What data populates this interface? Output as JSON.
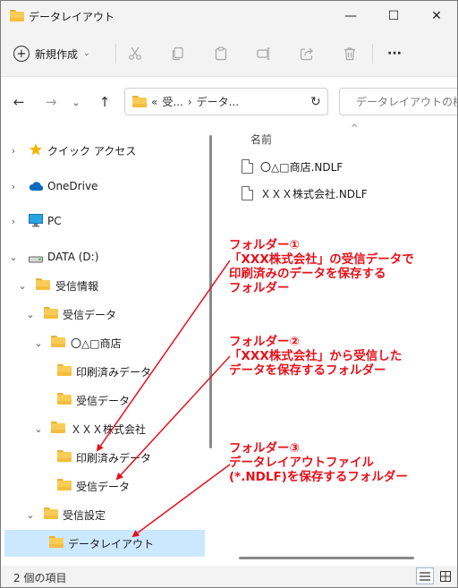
{
  "window": {
    "title": "データレイアウト",
    "minimize_glyph": "—",
    "maximize_glyph": "☐",
    "close_glyph": "✕"
  },
  "toolbar": {
    "new_label": "新規作成",
    "more_glyph": "···"
  },
  "address": {
    "overflow": "«",
    "segments": [
      "受...",
      "データ..."
    ],
    "separator": "›",
    "refresh_glyph": "↻"
  },
  "search": {
    "placeholder": "データレイアウトの検索"
  },
  "nav": {
    "items": [
      {
        "label": "クイック アクセス"
      },
      {
        "label": "OneDrive"
      },
      {
        "label": "PC"
      },
      {
        "label": "DATA (D:)"
      },
      {
        "label": "受信情報"
      },
      {
        "label": "受信データ"
      },
      {
        "label": "〇△□商店"
      },
      {
        "label": "印刷済みデータ"
      },
      {
        "label": "受信データ"
      },
      {
        "label": "ＸＸＸ株式会社"
      },
      {
        "label": "印刷済みデータ"
      },
      {
        "label": "受信データ"
      },
      {
        "label": "受信設定"
      },
      {
        "label": "データレイアウト"
      }
    ]
  },
  "content": {
    "column_name": "名前",
    "sort_glyph": "^",
    "files": [
      {
        "name": "〇△□商店.NDLF"
      },
      {
        "name": "ＸＸＸ株式会社.NDLF"
      }
    ]
  },
  "annotations": {
    "note1": [
      "フォルダー①",
      "「XXX株式会社」の受信データで",
      "印刷済みのデータを保存する",
      "フォルダー"
    ],
    "note2": [
      "フォルダー②",
      "「XXX株式会社」から受信した",
      "データを保存するフォルダー"
    ],
    "note3": [
      "フォルダー③",
      "データレイアウトファイル",
      "(*.NDLF)を保存するフォルダー"
    ],
    "color": "#e8101a"
  },
  "status": {
    "item_count": "2 個の項目"
  },
  "colors": {
    "selection": "#cce8ff",
    "folder": "#f8cc56",
    "annotation": "#e8101a"
  }
}
